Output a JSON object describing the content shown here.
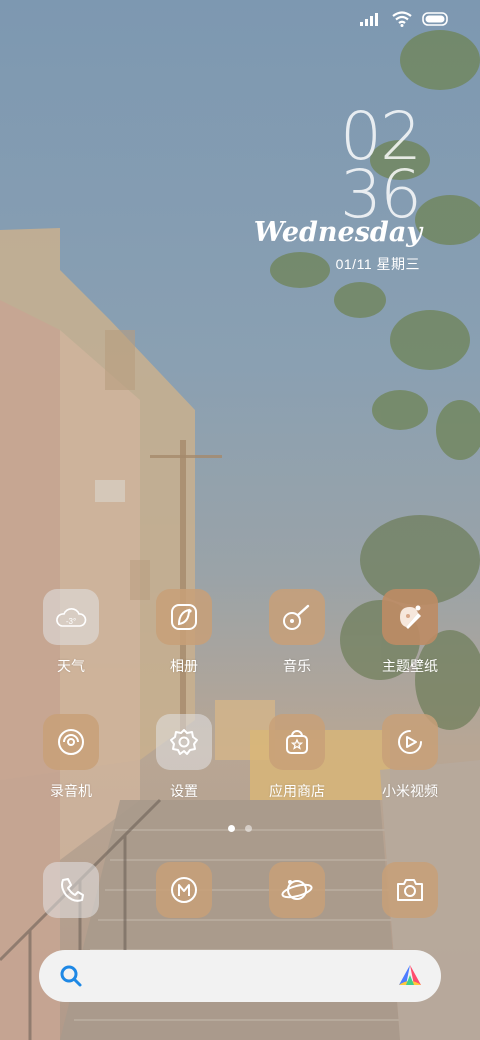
{
  "status_bar": {
    "icons": [
      "signal-icon",
      "wifi-icon",
      "battery-icon"
    ]
  },
  "clock": {
    "hour": "02",
    "minute": "36",
    "weekday": "Wednesday",
    "date": "01/11 星期三"
  },
  "apps_row1": [
    {
      "label": "天气",
      "icon": "weather-icon",
      "badge": "-3°"
    },
    {
      "label": "相册",
      "icon": "gallery-icon"
    },
    {
      "label": "音乐",
      "icon": "music-icon"
    },
    {
      "label": "主题壁纸",
      "icon": "themes-icon"
    }
  ],
  "apps_row2": [
    {
      "label": "录音机",
      "icon": "recorder-icon"
    },
    {
      "label": "设置",
      "icon": "settings-gear-icon"
    },
    {
      "label": "应用商店",
      "icon": "app-store-icon"
    },
    {
      "label": "小米视频",
      "icon": "video-icon"
    }
  ],
  "dock": [
    {
      "icon": "phone-icon"
    },
    {
      "icon": "messages-icon"
    },
    {
      "icon": "browser-icon"
    },
    {
      "icon": "camera-icon"
    }
  ],
  "pager": {
    "pages": 2,
    "active": 1
  },
  "search": {
    "icon": "search-icon",
    "assistant_icon": "assistant-icon"
  },
  "colors": {
    "tile_tan": "#c8a078",
    "tile_light": "#e1e1e4",
    "accent_blue": "#1e88e5"
  }
}
